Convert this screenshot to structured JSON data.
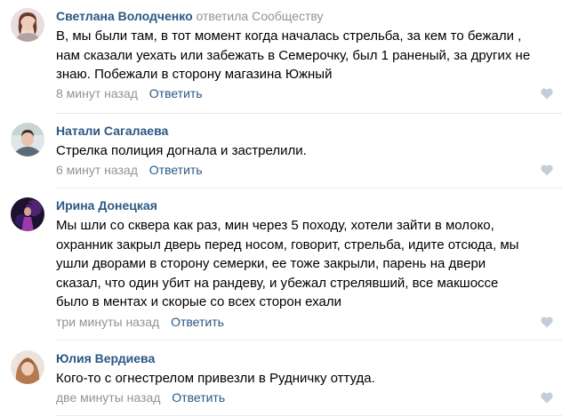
{
  "comments": [
    {
      "author": "Светлана Володченко",
      "reply_to": "ответила Сообществу",
      "text_lines": [
        "В, мы были там, в тот момент когда началась стрельба, за кем то бежали ,",
        "нам сказали уехать или забежать в Семерочку, был 1 раненый, за других не",
        "знаю. Побежали в сторону магазина Южный"
      ],
      "time": "8 минут назад",
      "reply_label": "Ответить"
    },
    {
      "author": "Натали Сагалаева",
      "reply_to": "",
      "text_lines": [
        "Стрелка полиция догнала и застрелили."
      ],
      "time": "6 минут назад",
      "reply_label": "Ответить"
    },
    {
      "author": "Ирина Донецкая",
      "reply_to": "",
      "text_lines": [
        "Мы шли со сквера как раз, мин через 5 походу, хотели зайти в молоко,",
        "охранник закрыл дверь перед носом, говорит, стрельба, идите отсюда, мы",
        "ушли дворами в сторону семерки, ее тоже закрыли, парень на двери",
        "сказал, что один убит на рандеву, и убежал стрелявший, все макшоссе",
        "было в ментах и скорые со всех сторон ехали"
      ],
      "time": "три минуты назад",
      "reply_label": "Ответить"
    },
    {
      "author": "Юлия Вердиева",
      "reply_to": "",
      "text_lines": [
        "Кого-то с огнестрелом привезли в Рудничку оттуда."
      ],
      "time": "две минуты назад",
      "reply_label": "Ответить"
    }
  ],
  "colors": {
    "author": "#2a5885",
    "muted": "#939393",
    "divider": "#e7e8ec",
    "like": "#c5cdd6"
  },
  "icons": {
    "like": "heart-icon"
  }
}
